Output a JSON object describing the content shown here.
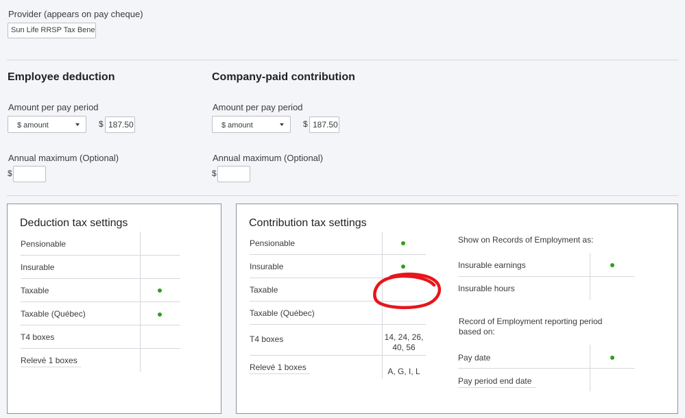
{
  "provider": {
    "label": "Provider (appears on pay cheque)",
    "value": "Sun Life RRSP Tax Benefit"
  },
  "employee": {
    "heading": "Employee deduction",
    "amount_label": "Amount per pay period",
    "type_value": "$ amount",
    "currency": "$",
    "amount_value": "187.50",
    "annual_label": "Annual maximum  (Optional)",
    "annual_currency": "$",
    "annual_value": ""
  },
  "company": {
    "heading": "Company-paid contribution",
    "amount_label": "Amount per pay period",
    "type_value": "$ amount",
    "currency": "$",
    "amount_value": "187.50",
    "annual_label": "Annual maximum  (Optional)",
    "annual_currency": "$",
    "annual_value": ""
  },
  "deduction_tax": {
    "heading": "Deduction tax settings",
    "rows": [
      {
        "label": "Pensionable",
        "checked": false
      },
      {
        "label": "Insurable",
        "checked": false
      },
      {
        "label": "Taxable",
        "checked": true
      },
      {
        "label": "Taxable (Québec)",
        "checked": true
      },
      {
        "label": "T4 boxes",
        "value": ""
      },
      {
        "label": "Relevé 1 boxes",
        "value": ""
      }
    ]
  },
  "contribution_tax": {
    "heading": "Contribution tax settings",
    "rows": [
      {
        "label": "Pensionable",
        "checked": true
      },
      {
        "label": "Insurable",
        "checked": true
      },
      {
        "label": "Taxable",
        "checked": false
      },
      {
        "label": "Taxable (Québec)",
        "checked": false
      },
      {
        "label": "T4 boxes",
        "value_line1": "14, 24, 26,",
        "value_line2": "40, 56"
      },
      {
        "label": "Relevé 1 boxes",
        "value": "A, G, I, L"
      }
    ],
    "roe_heading": "Show on Records of Employment as:",
    "roe_rows": [
      {
        "label": "Insurable earnings",
        "checked": true
      },
      {
        "label": "Insurable hours",
        "checked": false
      }
    ],
    "period_heading_line1": "Record of Employment reporting period",
    "period_heading_line2": "based on:",
    "period_rows": [
      {
        "label": "Pay date",
        "checked": true
      },
      {
        "label": "Pay period end date",
        "checked": false
      }
    ]
  },
  "colors": {
    "check_dot": "#2ca01c",
    "annotation": "#e8151b"
  }
}
